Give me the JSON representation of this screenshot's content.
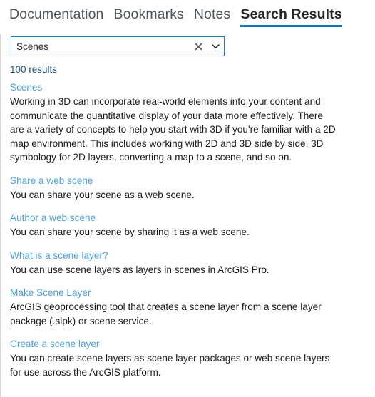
{
  "tabs": [
    {
      "label": "Documentation",
      "active": false
    },
    {
      "label": "Bookmarks",
      "active": false
    },
    {
      "label": "Notes",
      "active": false
    },
    {
      "label": "Search Results",
      "active": true
    }
  ],
  "search": {
    "value": "Scenes",
    "placeholder": "Search",
    "clear_icon": "close-x-icon",
    "dropdown_icon": "chevron-down-icon"
  },
  "results_count": "100 results",
  "results": [
    {
      "title": "Scenes",
      "snippet": "Working in 3D can incorporate real-world elements into your content and communicate the quantitative display of your data more effectively. There are a variety of concepts to help you start with 3D if you're familiar with a 2D map environment. This includes working with 2D and 3D side by side, 3D symbology for 2D layers, converting a map to a scene, and so on."
    },
    {
      "title": "Share a web scene",
      "snippet": "You can share your scene as a web scene."
    },
    {
      "title": "Author a web scene",
      "snippet": "You can share your scene by sharing it as a web scene."
    },
    {
      "title": "What is a scene layer?",
      "snippet": "You can use scene layers as layers in scenes in ArcGIS Pro."
    },
    {
      "title": "Make Scene Layer",
      "snippet": "ArcGIS geoprocessing tool that creates a scene layer from a scene layer package (.slpk) or scene service."
    },
    {
      "title": "Create a scene layer",
      "snippet": "You can create scene layers as scene layer packages or web scene layers for use across the ArcGIS platform."
    }
  ],
  "colors": {
    "accent": "#0b78bd",
    "link": "#4d9fd6",
    "count_text": "#1c4f7c",
    "body_text": "#1a1a1a",
    "tab_inactive": "#4f5559",
    "tab_active": "#262626",
    "search_border": "#1f7ec0"
  }
}
